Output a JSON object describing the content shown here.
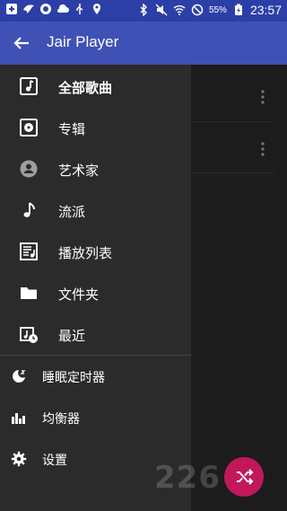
{
  "status_bar": {
    "battery_percent": "55%",
    "time": "23:57",
    "left_icons": [
      "add-notification-icon",
      "bird-icon",
      "cloud-icon",
      "cloud-sun-icon",
      "usb-icon",
      "location-icon"
    ],
    "right_icons": [
      "bluetooth-icon",
      "mute-icon",
      "wifi-icon",
      "do-not-disturb-icon",
      "battery-icon"
    ]
  },
  "app_bar": {
    "title": "Jair Player",
    "back_icon": "arrow-back-icon",
    "color": "#3f51b5"
  },
  "drawer": {
    "primary_items": [
      {
        "label": "全部歌曲",
        "icon": "music-note-list-icon",
        "selected": true
      },
      {
        "label": "专辑",
        "icon": "album-icon"
      },
      {
        "label": "艺术家",
        "icon": "artist-icon"
      },
      {
        "label": "流派",
        "icon": "genre-icon"
      },
      {
        "label": "播放列表",
        "icon": "playlist-icon"
      },
      {
        "label": "文件夹",
        "icon": "folder-icon"
      },
      {
        "label": "最近",
        "icon": "recent-icon"
      }
    ],
    "secondary_items": [
      {
        "label": "睡眠定时器",
        "icon": "sleep-timer-icon"
      },
      {
        "label": "均衡器",
        "icon": "equalizer-icon"
      },
      {
        "label": "设置",
        "icon": "settings-icon"
      }
    ]
  },
  "fab": {
    "icon": "shuffle-icon",
    "color": "#c2185b"
  },
  "watermark": {
    "text": "226"
  }
}
